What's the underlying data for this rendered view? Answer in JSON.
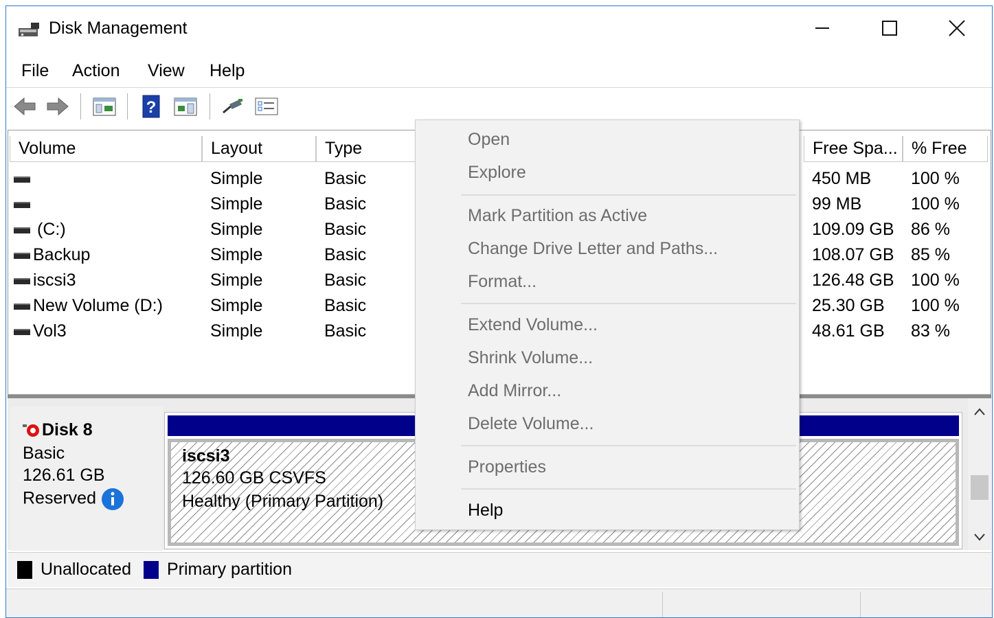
{
  "window": {
    "title": "Disk Management"
  },
  "menubar": {
    "items": [
      "File",
      "Action",
      "View",
      "Help"
    ]
  },
  "volume_list": {
    "columns": [
      "Volume",
      "Layout",
      "Type",
      "Free Spa...",
      "% Free"
    ],
    "rows": [
      {
        "volume": "",
        "layout": "Simple",
        "type": "Basic",
        "free_space": "450 MB",
        "pct_free": "100 %"
      },
      {
        "volume": "",
        "layout": "Simple",
        "type": "Basic",
        "free_space": "99 MB",
        "pct_free": "100 %"
      },
      {
        "volume": "(C:)",
        "layout": "Simple",
        "type": "Basic",
        "free_space": "109.09 GB",
        "pct_free": "86 %"
      },
      {
        "volume": "Backup",
        "layout": "Simple",
        "type": "Basic",
        "free_space": "108.07 GB",
        "pct_free": "85 %"
      },
      {
        "volume": "iscsi3",
        "layout": "Simple",
        "type": "Basic",
        "free_space": "126.48 GB",
        "pct_free": "100 %"
      },
      {
        "volume": "New Volume (D:)",
        "layout": "Simple",
        "type": "Basic",
        "free_space": "25.30 GB",
        "pct_free": "100 %"
      },
      {
        "volume": "Vol3",
        "layout": "Simple",
        "type": "Basic",
        "free_space": "48.61 GB",
        "pct_free": "83 %"
      }
    ]
  },
  "disk": {
    "name": "Disk 8",
    "type": "Basic",
    "size": "126.61 GB",
    "status": "Reserved",
    "partition": {
      "name": "iscsi3",
      "size_fs": "126.60 GB CSVFS",
      "health": "Healthy (Primary Partition)"
    }
  },
  "legend": {
    "items": [
      {
        "label": "Unallocated",
        "color": "#000000"
      },
      {
        "label": "Primary partition",
        "color": "#00008b"
      }
    ]
  },
  "context_menu": {
    "items": [
      {
        "label": "Open",
        "enabled": false
      },
      {
        "label": "Explore",
        "enabled": false
      },
      {
        "label": "Mark Partition as Active",
        "enabled": false
      },
      {
        "label": "Change Drive Letter and Paths...",
        "enabled": false
      },
      {
        "label": "Format...",
        "enabled": false
      },
      {
        "label": "Extend Volume...",
        "enabled": false
      },
      {
        "label": "Shrink Volume...",
        "enabled": false
      },
      {
        "label": "Add Mirror...",
        "enabled": false
      },
      {
        "label": "Delete Volume...",
        "enabled": false
      },
      {
        "label": "Properties",
        "enabled": false
      },
      {
        "label": "Help",
        "enabled": true
      }
    ]
  },
  "colors": {
    "accent": "#2b79d0",
    "primary_partition": "#00008b",
    "disabled_text": "#6d6d6d"
  }
}
